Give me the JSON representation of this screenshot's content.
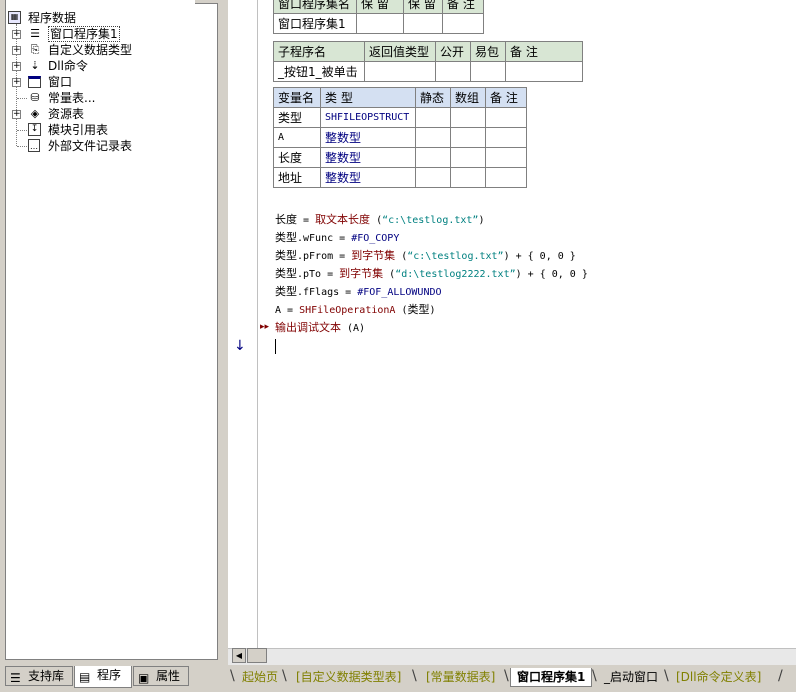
{
  "tree": {
    "root_label": "程序数据",
    "items": [
      {
        "label": "窗口程序集1",
        "icon": "layers-icon"
      },
      {
        "label": "自定义数据类型",
        "icon": "data-type-icon"
      },
      {
        "label": "Dll命令",
        "icon": "dll-icon"
      },
      {
        "label": "窗口",
        "icon": "window-icon"
      },
      {
        "label": "常量表...",
        "icon": "constant-icon"
      },
      {
        "label": "资源表",
        "icon": "resource-icon"
      },
      {
        "label": "模块引用表",
        "icon": "module-icon"
      },
      {
        "label": "外部文件记录表",
        "icon": "file-icon"
      }
    ]
  },
  "left_tabs": {
    "support": "支持库",
    "program": "程序",
    "property": "属性"
  },
  "assembly_table": {
    "headers": [
      "窗口程序集名",
      "保 留",
      "保 留",
      "备 注"
    ],
    "row": [
      "窗口程序集1",
      "",
      "",
      ""
    ]
  },
  "sub_table": {
    "headers": [
      "子程序名",
      "返回值类型",
      "公开",
      "易包",
      "备 注"
    ],
    "row": [
      "_按钮1_被单击",
      "",
      "",
      "",
      ""
    ]
  },
  "var_table": {
    "headers": [
      "变量名",
      "类 型",
      "静态",
      "数组",
      "备 注"
    ],
    "rows": [
      [
        "类型",
        "SHFILEOPSTRUCT"
      ],
      [
        "A",
        "整数型"
      ],
      [
        "长度",
        "整数型"
      ],
      [
        "地址",
        "整数型"
      ]
    ]
  },
  "code": {
    "l1": {
      "a": "长度",
      "b": " = ",
      "c": "取文本长度",
      "d": " (",
      "e": "“c:\\testlog.txt”",
      "f": ")"
    },
    "l2": {
      "a": "类型",
      "b": ".wFunc = ",
      "c": "#FO_COPY"
    },
    "l3": {
      "a": "类型",
      "b": ".pFrom = ",
      "c": "到字节集",
      "d": " (",
      "e": "“c:\\testlog.txt”",
      "f": ") + { 0, 0 }"
    },
    "l4": {
      "a": "类型",
      "b": ".pTo = ",
      "c": "到字节集",
      "d": " (",
      "e": "“d:\\testlog2222.txt”",
      "f": ") + { 0, 0 }"
    },
    "l5": {
      "a": "类型",
      "b": ".fFlags = ",
      "c": "#FOF_ALLOWUNDO"
    },
    "l6": {
      "a": "A = ",
      "b": "SHFileOperationA",
      "c": " (",
      "d": "类型",
      "e": ")"
    },
    "l7": {
      "a": "输出调试文本",
      "b": " (A)"
    }
  },
  "gutter": {
    "breakpoint": "▸▸",
    "arrow": "↓"
  },
  "bottom_tabs": [
    "起始页",
    "[自定义数据类型表]",
    "[常量数据表]",
    "窗口程序集1",
    "_启动窗口",
    "[Dll命令定义表]"
  ],
  "colors": {
    "function": "#800000",
    "string": "#008080",
    "type": "#000080",
    "tab_text": "#808000"
  }
}
